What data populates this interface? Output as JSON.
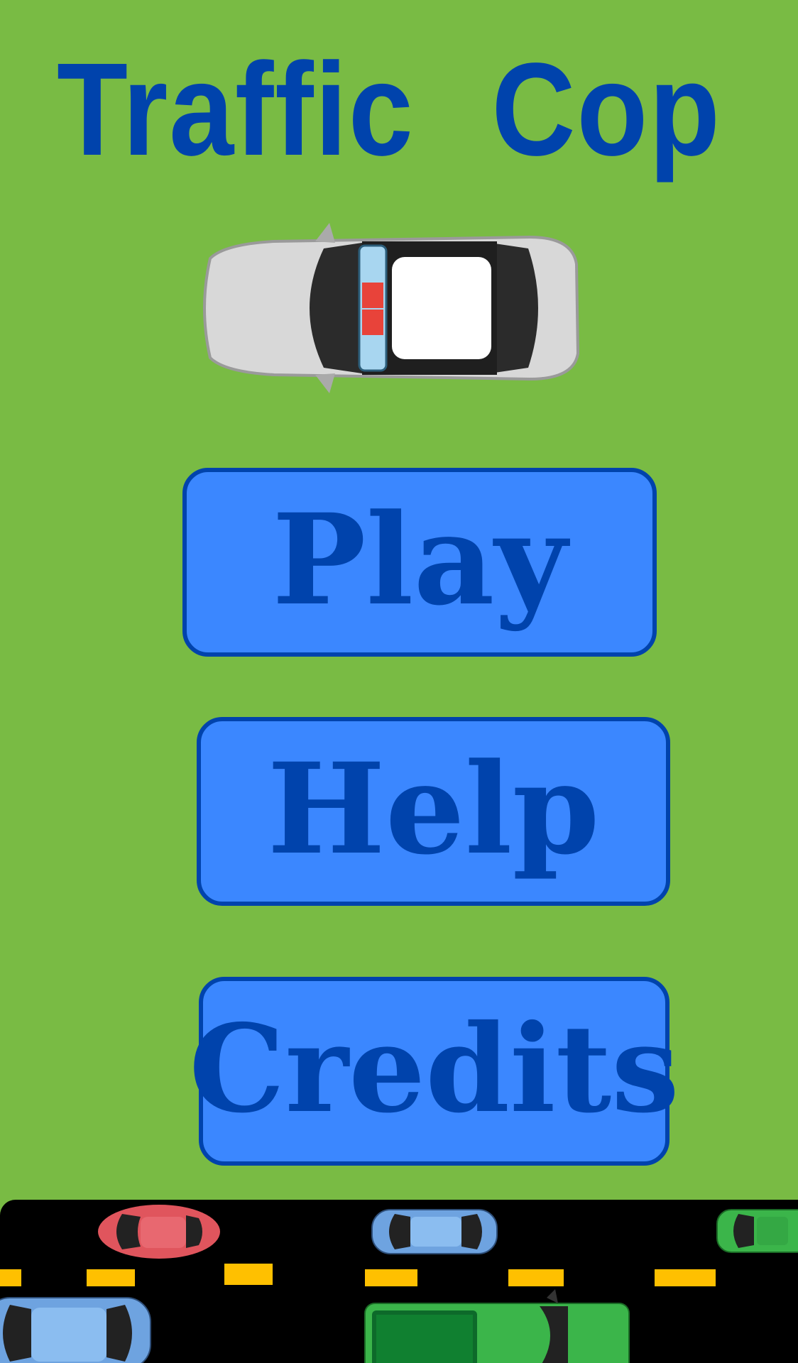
{
  "game": {
    "title": "Traffic   Cop"
  },
  "hero": {
    "vehicle": "police-car-icon"
  },
  "menu": {
    "play_label": "Play",
    "help_label": "Help",
    "credits_label": "Credits"
  },
  "road": {
    "vehicles": [
      "red-hatchback",
      "blue-sedan",
      "green-sedan",
      "blue-sedan",
      "green-pickup-truck"
    ]
  },
  "colors": {
    "background": "#79bb44",
    "title": "#0043ac",
    "button_fill": "#3b87ff",
    "button_border": "#0043ac",
    "road": "#000000",
    "lane_marking": "#ffc000"
  }
}
